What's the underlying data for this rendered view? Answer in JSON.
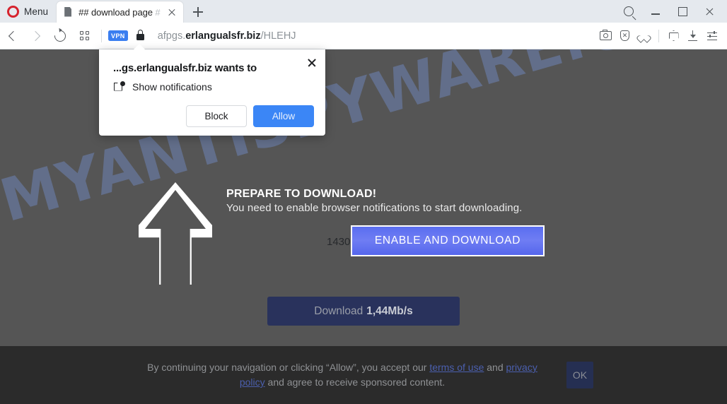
{
  "browser": {
    "menu_label": "Menu",
    "tab": {
      "title": "## download page",
      "title_suffix": "#",
      "favicon": "page-icon"
    },
    "newtab_icon": "plus-icon",
    "window_controls": {
      "search": "search-icon",
      "minimize": "minimize-icon",
      "maximize": "maximize-icon",
      "close": "close-icon"
    },
    "toolbar": {
      "back_icon": "chevron-left-icon",
      "forward_icon": "chevron-right-icon",
      "reload_icon": "reload-icon",
      "speeddial_icon": "grid-icon",
      "vpn_badge": "VPN",
      "lock_icon": "lock-icon",
      "url_subdomain": "afpgs.",
      "url_domain": "erlangualsfr.biz",
      "url_path": "/HLEHJ",
      "url_full": "afpgs.erlangualsfr.biz/HLEHJ",
      "right_icons": [
        "camera-icon",
        "shield-block-icon",
        "heart-icon",
        "cube-icon",
        "download-icon",
        "sliders-icon"
      ]
    }
  },
  "notification_popup": {
    "title": "...gs.erlangualsfr.biz wants to",
    "permission_icon": "notification-icon",
    "permission_label": "Show notifications",
    "block_label": "Block",
    "allow_label": "Allow",
    "close_icon": "close-icon"
  },
  "page": {
    "watermark": "MYANTISPYWARE.COM",
    "arrow_icon": "arrow-up-icon",
    "headline": "PREPARE TO DOWNLOAD!",
    "subline": "You need to enable browser notifications to start downloading.",
    "counter": "1430",
    "enable_button": "ENABLE AND DOWNLOAD",
    "download_button_prefix": "Download",
    "download_button_speed": "1,44Mb/s"
  },
  "consent_banner": {
    "text_part1": "By continuing your navigation or clicking “Allow”, you accept our ",
    "link_terms": "terms of use",
    "text_and": " and ",
    "link_privacy": "privacy policy",
    "text_part2": " and agree to receive sponsored content.",
    "ok_label": "OK"
  },
  "colors": {
    "page_background": "#555555",
    "banner_background": "#2b2b2b",
    "accent_blue": "#5a6ef0",
    "allow_blue": "#3b86f6",
    "vpn_blue": "#3a7ef0",
    "download_navy": "#29325c",
    "watermark_blue": "#6f86bb",
    "opera_red": "#d6232e"
  }
}
